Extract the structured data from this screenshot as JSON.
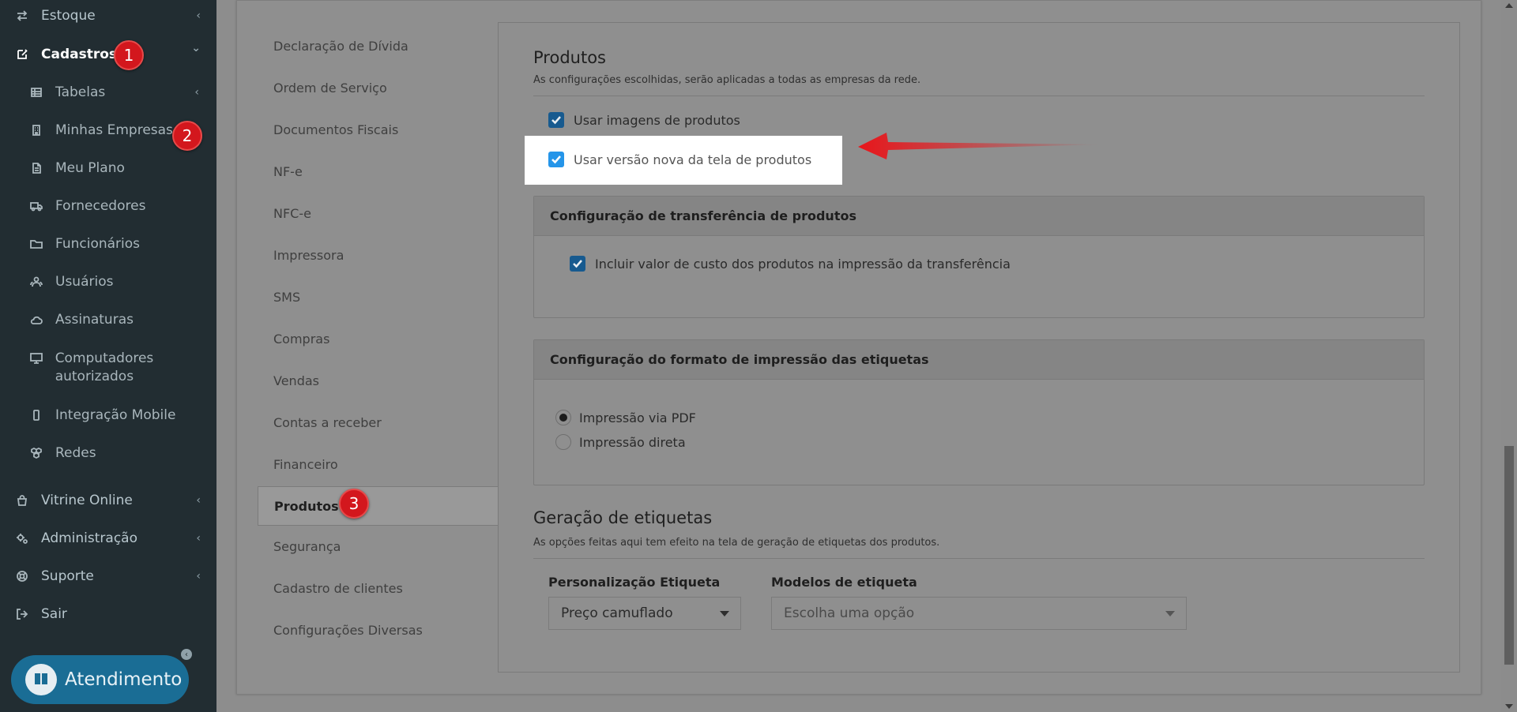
{
  "sidebar": {
    "items": [
      {
        "label": "Estoque",
        "icon": "exchange-icon",
        "chevron": "‹"
      },
      {
        "label": "Cadastros",
        "icon": "edit-icon",
        "chevron": "⌄"
      },
      {
        "label": "Tabelas",
        "icon": "table-icon",
        "chevron": "‹"
      },
      {
        "label": "Minhas Empresas",
        "icon": "building-icon"
      },
      {
        "label": "Meu Plano",
        "icon": "file-icon"
      },
      {
        "label": "Fornecedores",
        "icon": "truck-icon"
      },
      {
        "label": "Funcionários",
        "icon": "folder-icon"
      },
      {
        "label": "Usuários",
        "icon": "users-icon"
      },
      {
        "label": "Assinaturas",
        "icon": "cloud-icon"
      },
      {
        "label": "Computadores autorizados",
        "icon": "desktop-icon"
      },
      {
        "label": "Integração Mobile",
        "icon": "mobile-icon"
      },
      {
        "label": "Redes",
        "icon": "cubes-icon"
      },
      {
        "label": "Vitrine Online",
        "icon": "shopping-bag-icon",
        "chevron": "‹"
      },
      {
        "label": "Administração",
        "icon": "cogs-icon",
        "chevron": "‹"
      },
      {
        "label": "Suporte",
        "icon": "lifebuoy-icon",
        "chevron": "‹"
      },
      {
        "label": "Sair",
        "icon": "sign-out-icon"
      }
    ],
    "collapse_icon": "‹",
    "atendimento_label": "Atendimento"
  },
  "badges": [
    "1",
    "2",
    "3"
  ],
  "tabs": [
    "Declaração de Dívida",
    "Ordem de Serviço",
    "Documentos Fiscais",
    "NF-e",
    "NFC-e",
    "Impressora",
    "SMS",
    "Compras",
    "Vendas",
    "Contas a receber",
    "Financeiro",
    "Produtos",
    "Segurança",
    "Cadastro de clientes",
    "Configurações Diversas"
  ],
  "active_tab": "Produtos",
  "produtos": {
    "title": "Produtos",
    "description": "As configurações escolhidas, serão aplicadas a todas as empresas da rede.",
    "opt_images": "Usar imagens de produtos",
    "opt_new_screen": "Usar versão nova da tela de produtos",
    "opt_images_checked": true,
    "opt_new_screen_checked": true
  },
  "transfer_card": {
    "title": "Configuração de transferência de produtos",
    "opt_cost": "Incluir valor de custo dos produtos na impressão da transferência",
    "opt_cost_checked": true
  },
  "label_format_card": {
    "title": "Configuração do formato de impressão das etiquetas",
    "options": [
      "Impressão via PDF",
      "Impressão direta"
    ],
    "selected": "Impressão via PDF"
  },
  "geracao": {
    "title": "Geração de etiquetas",
    "description": "As opções feitas aqui tem efeito na tela de geração de etiquetas dos produtos.",
    "personalizacao_label": "Personalização Etiqueta",
    "personalizacao_value": "Preço camuflado",
    "modelos_label": "Modelos de etiqueta",
    "modelos_placeholder": "Escolha uma opção"
  },
  "colors": {
    "sidebar_bg": "#222d32",
    "badge": "#d3171d",
    "checkbox_active": "#2595e9",
    "arrow": "#e8161b",
    "atendimento": "#1a6d95"
  }
}
